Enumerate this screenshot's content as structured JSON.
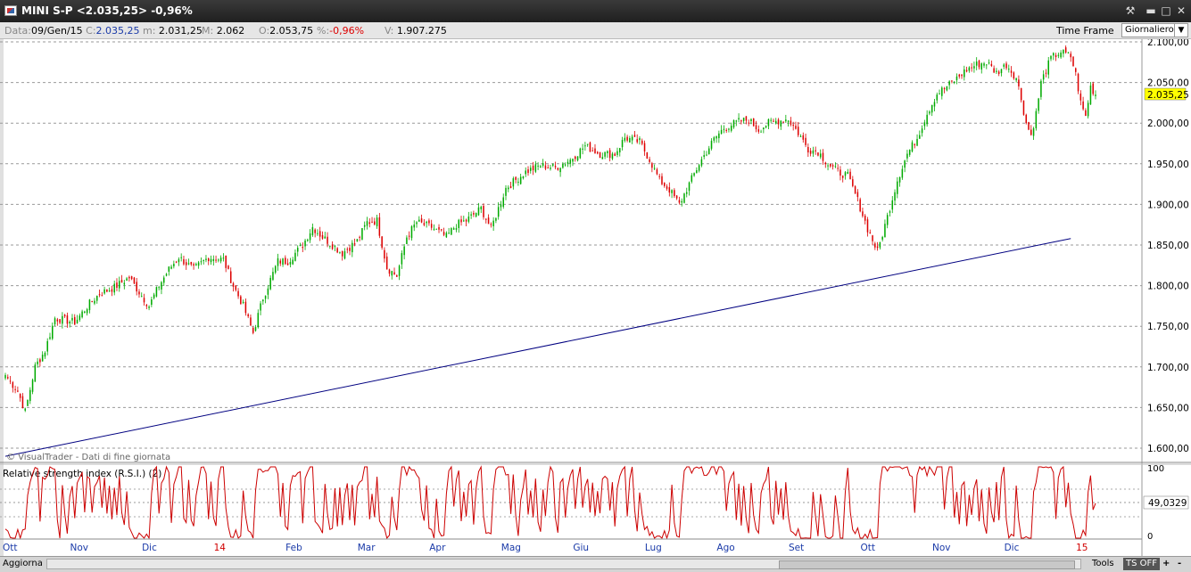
{
  "window": {
    "title": "MINI S-P <2.035,25> -0,96%",
    "controls": [
      "tools-icon",
      "minimize-icon",
      "maximize-icon",
      "close-icon"
    ]
  },
  "infobar": {
    "data_label": "Data:",
    "data_value": "09/Gen/15",
    "close_label": "C:",
    "close_value": "2.035,25",
    "min_label": "m:",
    "min_value": "2.031,25",
    "max_label": "M:",
    "max_value": "2.062",
    "open_label": "O:",
    "open_value": "2.053,75",
    "pct_label": "%:",
    "pct_value": "-0,96%",
    "vol_label": "V:",
    "vol_value": "1.907.275",
    "timeframe_label": "Time Frame",
    "timeframe_value": "Giornaliero"
  },
  "watermark": "© VisualTrader - Dati di fine giornata",
  "rsi_title": "Relative strength index (R.S.I.) (2)",
  "rsi_value_label": "49,0329",
  "rsi_axis": [
    "100",
    "0"
  ],
  "last_price_label": "2.035,25",
  "x_labels": [
    {
      "text": "Ott",
      "red": false
    },
    {
      "text": "Nov",
      "red": false
    },
    {
      "text": "Dic",
      "red": false
    },
    {
      "text": "14",
      "red": true
    },
    {
      "text": "Feb",
      "red": false
    },
    {
      "text": "Mar",
      "red": false
    },
    {
      "text": "Apr",
      "red": false
    },
    {
      "text": "Mag",
      "red": false
    },
    {
      "text": "Giu",
      "red": false
    },
    {
      "text": "Lug",
      "red": false
    },
    {
      "text": "Ago",
      "red": false
    },
    {
      "text": "Set",
      "red": false
    },
    {
      "text": "Ott",
      "red": false
    },
    {
      "text": "Nov",
      "red": false
    },
    {
      "text": "Dic",
      "red": false
    },
    {
      "text": "15",
      "red": true
    }
  ],
  "bottombar": {
    "refresh_label": "Aggiorna",
    "tools_label": "Tools",
    "ts_label": "TS OFF",
    "plus_label": "+",
    "minus_label": "-"
  },
  "colors": {
    "up": "#00aa00",
    "down": "#dd0000",
    "trendline": "#000080",
    "rsi": "#cc0000",
    "highlight": "#ffff00"
  },
  "chart_data": [
    {
      "type": "candlestick",
      "title": "MINI S-P",
      "ylim": [
        1600,
        2100
      ],
      "y_ticks": [
        "1.600,00",
        "1.650,00",
        "1.700,00",
        "1.750,00",
        "1.800,00",
        "1.850,00",
        "1.900,00",
        "1.950,00",
        "2.000,00",
        "2.050,00",
        "2.100,00"
      ],
      "y_tick_values": [
        1600,
        1650,
        1700,
        1750,
        1800,
        1850,
        1900,
        1950,
        2000,
        2050,
        2100
      ],
      "grid": true,
      "months": [
        "Ott",
        "Nov",
        "Dic",
        "14",
        "Feb",
        "Mar",
        "Apr",
        "Mag",
        "Giu",
        "Lug",
        "Ago",
        "Set",
        "Ott",
        "Nov",
        "Dic",
        "15"
      ],
      "close_anchors": [
        [
          0,
          1690
        ],
        [
          5,
          1670
        ],
        [
          8,
          1645
        ],
        [
          12,
          1700
        ],
        [
          16,
          1720
        ],
        [
          20,
          1760
        ],
        [
          28,
          1755
        ],
        [
          34,
          1778
        ],
        [
          38,
          1790
        ],
        [
          44,
          1798
        ],
        [
          50,
          1810
        ],
        [
          54,
          1792
        ],
        [
          58,
          1775
        ],
        [
          62,
          1800
        ],
        [
          66,
          1820
        ],
        [
          70,
          1835
        ],
        [
          76,
          1820
        ],
        [
          82,
          1835
        ],
        [
          88,
          1832
        ],
        [
          92,
          1800
        ],
        [
          96,
          1775
        ],
        [
          100,
          1742
        ],
        [
          104,
          1785
        ],
        [
          110,
          1830
        ],
        [
          114,
          1830
        ],
        [
          120,
          1850
        ],
        [
          124,
          1872
        ],
        [
          128,
          1860
        ],
        [
          132,
          1850
        ],
        [
          136,
          1840
        ],
        [
          142,
          1855
        ],
        [
          146,
          1878
        ],
        [
          150,
          1880
        ],
        [
          154,
          1822
        ],
        [
          158,
          1812
        ],
        [
          162,
          1860
        ],
        [
          166,
          1878
        ],
        [
          172,
          1872
        ],
        [
          178,
          1860
        ],
        [
          182,
          1875
        ],
        [
          186,
          1880
        ],
        [
          192,
          1895
        ],
        [
          196,
          1870
        ],
        [
          202,
          1920
        ],
        [
          210,
          1940
        ],
        [
          216,
          1948
        ],
        [
          222,
          1945
        ],
        [
          228,
          1955
        ],
        [
          234,
          1972
        ],
        [
          240,
          1962
        ],
        [
          246,
          1962
        ],
        [
          250,
          1982
        ],
        [
          256,
          1977
        ],
        [
          260,
          1955
        ],
        [
          264,
          1930
        ],
        [
          268,
          1918
        ],
        [
          272,
          1900
        ],
        [
          276,
          1925
        ],
        [
          280,
          1950
        ],
        [
          286,
          1980
        ],
        [
          290,
          1994
        ],
        [
          296,
          2002
        ],
        [
          300,
          2004
        ],
        [
          304,
          1992
        ],
        [
          308,
          2000
        ],
        [
          312,
          2003
        ],
        [
          316,
          2005
        ],
        [
          320,
          1988
        ],
        [
          324,
          1968
        ],
        [
          328,
          1965
        ],
        [
          332,
          1950
        ],
        [
          336,
          1940
        ],
        [
          340,
          1935
        ],
        [
          344,
          1905
        ],
        [
          348,
          1870
        ],
        [
          352,
          1842
        ],
        [
          356,
          1885
        ],
        [
          360,
          1930
        ],
        [
          364,
          1962
        ],
        [
          368,
          1982
        ],
        [
          372,
          2012
        ],
        [
          376,
          2036
        ],
        [
          380,
          2045
        ],
        [
          384,
          2055
        ],
        [
          388,
          2066
        ],
        [
          392,
          2072
        ],
        [
          396,
          2075
        ],
        [
          400,
          2062
        ],
        [
          404,
          2072
        ],
        [
          408,
          2056
        ],
        [
          410,
          2030
        ],
        [
          412,
          2000
        ],
        [
          414,
          1985
        ],
        [
          416,
          2012
        ],
        [
          418,
          2050
        ],
        [
          422,
          2080
        ],
        [
          426,
          2088
        ],
        [
          430,
          2082
        ],
        [
          432,
          2060
        ],
        [
          434,
          2025
        ],
        [
          436,
          2008
        ],
        [
          438,
          2045
        ],
        [
          440,
          2035
        ]
      ],
      "trendline": [
        [
          0,
          1590
        ],
        [
          430,
          1858
        ]
      ],
      "last_price": 2035.25
    },
    {
      "type": "line",
      "title": "Relative strength index (R.S.I.) (2)",
      "ylim": [
        0,
        100
      ],
      "last_value": 49.0329
    }
  ]
}
